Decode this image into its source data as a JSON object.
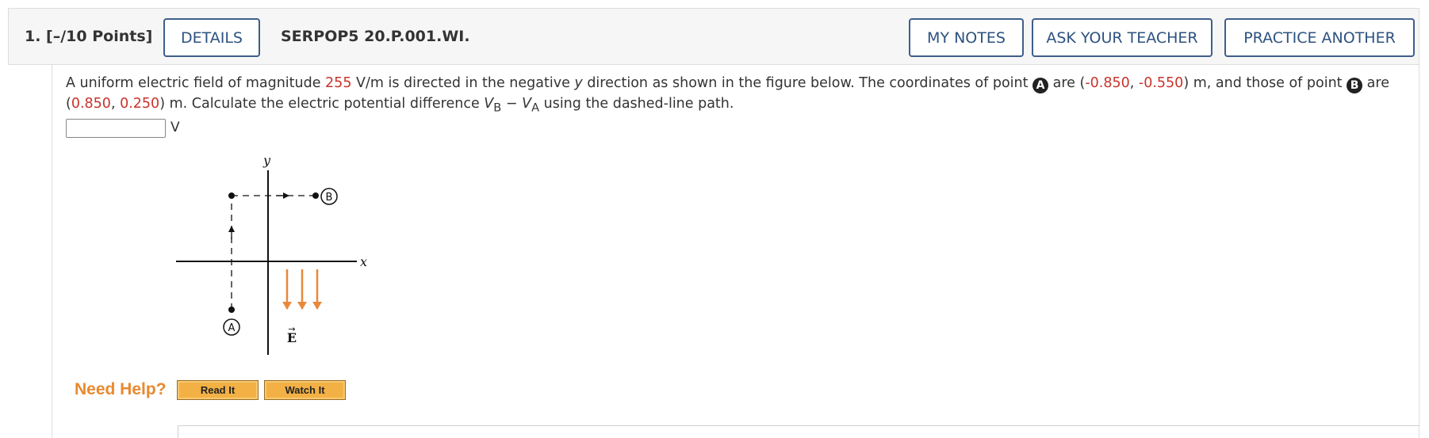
{
  "header": {
    "question_label": "1.  [–/10 Points]",
    "details_label": "DETAILS",
    "problem_code": "SERPOP5 20.P.001.WI.",
    "my_notes_label": "MY NOTES",
    "ask_teacher_label": "ASK YOUR TEACHER",
    "practice_label": "PRACTICE ANOTHER"
  },
  "question": {
    "p1": "A uniform electric field of magnitude ",
    "magnitude": "255",
    "p2": " V/m is directed in the negative ",
    "p2_var": "y",
    "p3": " direction as shown in the figure below. The coordinates of point ",
    "point_a": "A",
    "p4": " are (",
    "ax": "-0.850",
    "sep1": ", ",
    "ay": "-0.550",
    "p5": ") m, and those of point ",
    "point_b": "B",
    "p6": " are (",
    "bx": "0.850",
    "sep2": ", ",
    "by": "0.250",
    "p7": ") m. Calculate the electric potential difference ",
    "vb_v": "V",
    "vb_sub": "B",
    "minus": " − ",
    "va_v": "V",
    "va_sub": "A",
    "p8": " using the dashed-line path."
  },
  "answer": {
    "value": "",
    "unit": "V"
  },
  "figure": {
    "y_label": "y",
    "x_label": "x",
    "point_a_label": "A",
    "point_b_label": "B",
    "field_label": "E",
    "field_arrow": "→",
    "axis_color": "#111111",
    "field_color": "#e8893a"
  },
  "help": {
    "label": "Need Help?",
    "read_label": "Read It",
    "watch_label": "Watch It"
  }
}
